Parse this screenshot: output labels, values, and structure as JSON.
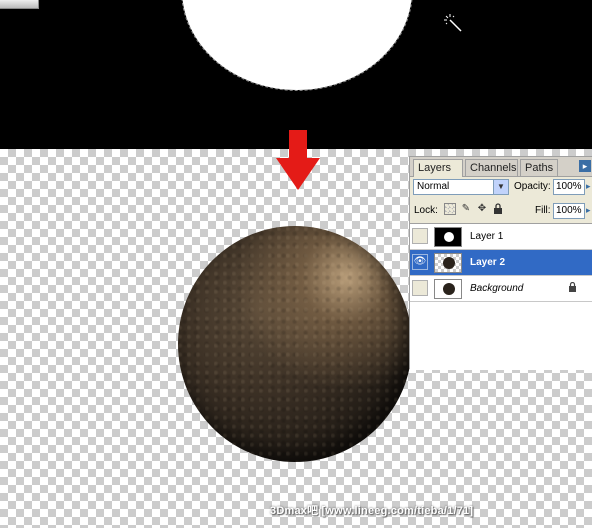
{
  "canvas": {
    "arrow_color": "#e41b17",
    "sphere_colors": {
      "dark": "#1e1914",
      "highlight": "#cdaf87"
    }
  },
  "palette": {
    "tabs": [
      "Layers ×",
      "Channels",
      "Paths"
    ],
    "menu_arrow": "▸",
    "blend_mode": "Normal",
    "opacity_label": "Opacity:",
    "opacity_value": "100%",
    "lock_label": "Lock:",
    "fill_label": "Fill:",
    "fill_value": "100%",
    "selected_color": "#316ac5",
    "layers": [
      {
        "name": "Layer 1",
        "visible": false,
        "selected": false,
        "thumbnail": "white-circle-on-black"
      },
      {
        "name": "Layer 2",
        "visible": true,
        "selected": true,
        "thumbnail": "dark-sphere-on-transparent"
      },
      {
        "name": "Background",
        "visible": false,
        "selected": false,
        "locked": true,
        "thumbnail": "dark-sphere-on-white"
      }
    ]
  },
  "icons": {
    "eye": "👁",
    "lock": "🔒",
    "move": "✥",
    "brush": "✎",
    "dropdown": "▼"
  },
  "watermark": "3Dmax吧 [www.lineeg.com/tieba/1/71]"
}
